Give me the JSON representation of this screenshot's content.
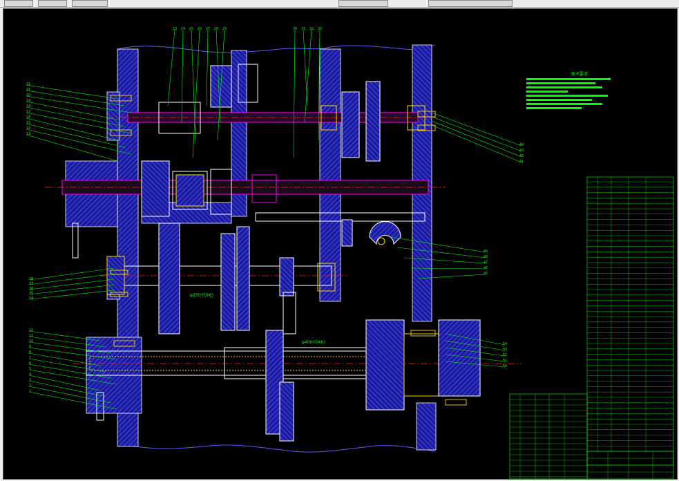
{
  "drawing": {
    "top_callouts": [
      "23",
      "24",
      "25",
      "26",
      "27",
      "28",
      "29",
      "30",
      "31",
      "32",
      "33"
    ],
    "left_callouts_upper": [
      "22",
      "21",
      "20",
      "19",
      "18",
      "17",
      "16",
      "15",
      "14",
      "13"
    ],
    "left_callouts_lower": [
      "38",
      "37",
      "36",
      "35",
      "34"
    ],
    "left_callouts_bottom": [
      "12",
      "11",
      "10",
      "9",
      "8",
      "7",
      "6",
      "5",
      "4",
      "3",
      "2",
      "1"
    ],
    "right_callouts_upper": [
      "44",
      "43",
      "42",
      "41"
    ],
    "right_callouts_mid": [
      "49",
      "48",
      "47",
      "46",
      "45"
    ],
    "right_callouts_lower": [
      "54",
      "53",
      "52",
      "51",
      "50"
    ],
    "notes_title": "技术要求",
    "shaft_label_1": "φ25(H7/k6)",
    "shaft_label_2": "φ40(H7/k6)"
  },
  "colors": {
    "background": "#000000",
    "housing": "#1a1aa8",
    "hatch": "#4a4aff",
    "outline": "#ffffff",
    "leader": "#00ff00",
    "center": "#ff2020",
    "bolt": "#ffd700",
    "magenta": "#ff00ff",
    "cyan": "#00ffff"
  }
}
